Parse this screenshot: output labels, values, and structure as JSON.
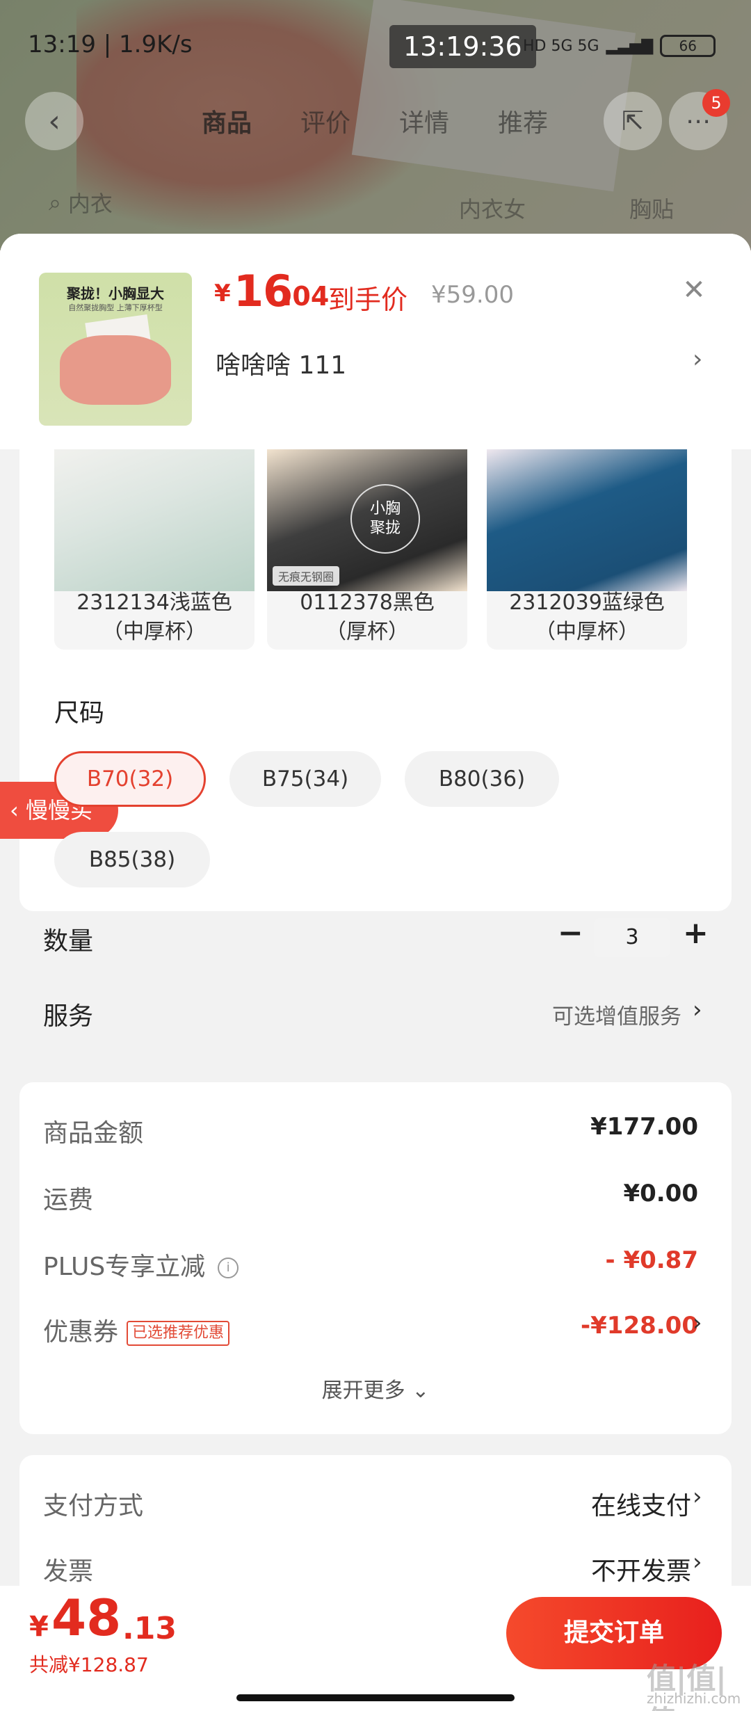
{
  "status_bar": {
    "left": "13:19 | 1.9K/s",
    "clock": "13:19:36",
    "network": "HD 5G 5G",
    "battery": "66"
  },
  "background_page": {
    "tabs": [
      "商品",
      "评价",
      "详情",
      "推荐"
    ],
    "badge_count": "5",
    "search_hint_1": "内衣",
    "search_hint_2": "内衣女",
    "search_hint_3": "胸贴"
  },
  "sheet": {
    "thumb_title": "聚拢！小胸显大",
    "thumb_subtitle": "自然聚拢胸型 上薄下厚杯型",
    "price_symbol": "¥",
    "price_integer": "16",
    "price_decimal": ".04",
    "price_label": "到手价",
    "original_price": "¥59.00",
    "selected_variant": "啥啥啥  111",
    "variants": [
      {
        "line1": "2312134浅蓝色",
        "line2": "（中厚杯）"
      },
      {
        "line1": "0112378黑色",
        "line2": "（厚杯）",
        "badge": "小胸\n聚拢",
        "tag": "无痕无钢圈"
      },
      {
        "line1": "2312039蓝绿色",
        "line2": "（中厚杯）"
      }
    ],
    "slow_buy": "慢慢买",
    "size_title": "尺码",
    "sizes": [
      "B70(32)",
      "B75(34)",
      "B80(36)",
      "B85(38)"
    ],
    "selected_size": "B70(32)",
    "quantity_label": "数量",
    "quantity_value": "3",
    "service_label": "服务",
    "service_value": "可选增值服务"
  },
  "price_breakdown": {
    "goods_amount_label": "商品金额",
    "goods_amount": "¥177.00",
    "shipping_label": "运费",
    "shipping": "¥0.00",
    "plus_label": "PLUS专享立减",
    "plus_value": "- ¥0.87",
    "coupon_label": "优惠券",
    "coupon_tag": "已选推荐优惠",
    "coupon_value": "-¥128.00",
    "expand": "展开更多"
  },
  "payment": {
    "method_label": "支付方式",
    "method_value": "在线支付",
    "invoice_label": "发票",
    "invoice_value": "不开发票"
  },
  "bottom": {
    "total_symbol": "¥",
    "total_integer": "48",
    "total_decimal": ".13",
    "total_save": "共减¥128.87",
    "submit": "提交订单"
  },
  "watermark": {
    "main": "值|值|值",
    "sub": "zhizhizhi.com"
  },
  "colors": {
    "accent": "#e22b1f",
    "selected_border": "#e4412f",
    "sheet_bg": "#f2f2f2"
  }
}
